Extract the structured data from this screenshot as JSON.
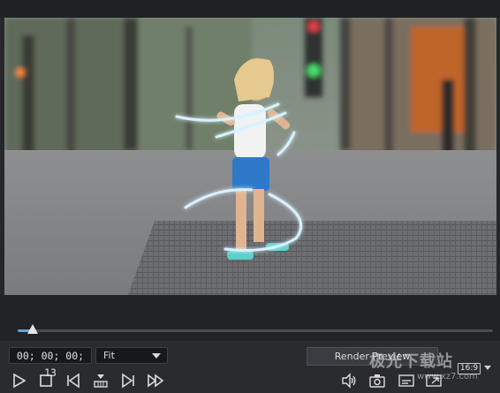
{
  "preview": {
    "description_icon": "video-frame"
  },
  "timeline": {
    "progress": 0.03
  },
  "controls": {
    "timecode": "00; 00; 00; 13",
    "fit_value": "Fit",
    "render_label": "Render Preview",
    "aspect_ratio": "16:9"
  },
  "watermark": {
    "text": "极光下载站",
    "url": "www.xz7.com"
  },
  "icons": {
    "play": "play-icon",
    "stop": "stop-icon",
    "prev_frame": "previous-frame-icon",
    "marker": "marker-icon",
    "next_frame": "next-frame-icon",
    "fast_forward": "fast-forward-icon",
    "volume": "volume-icon",
    "snapshot": "camera-icon",
    "subtitle": "subtitle-icon",
    "fullscreen": "fullscreen-icon"
  },
  "colors": {
    "accent": "#5fa6e0",
    "background": "#26272a"
  }
}
